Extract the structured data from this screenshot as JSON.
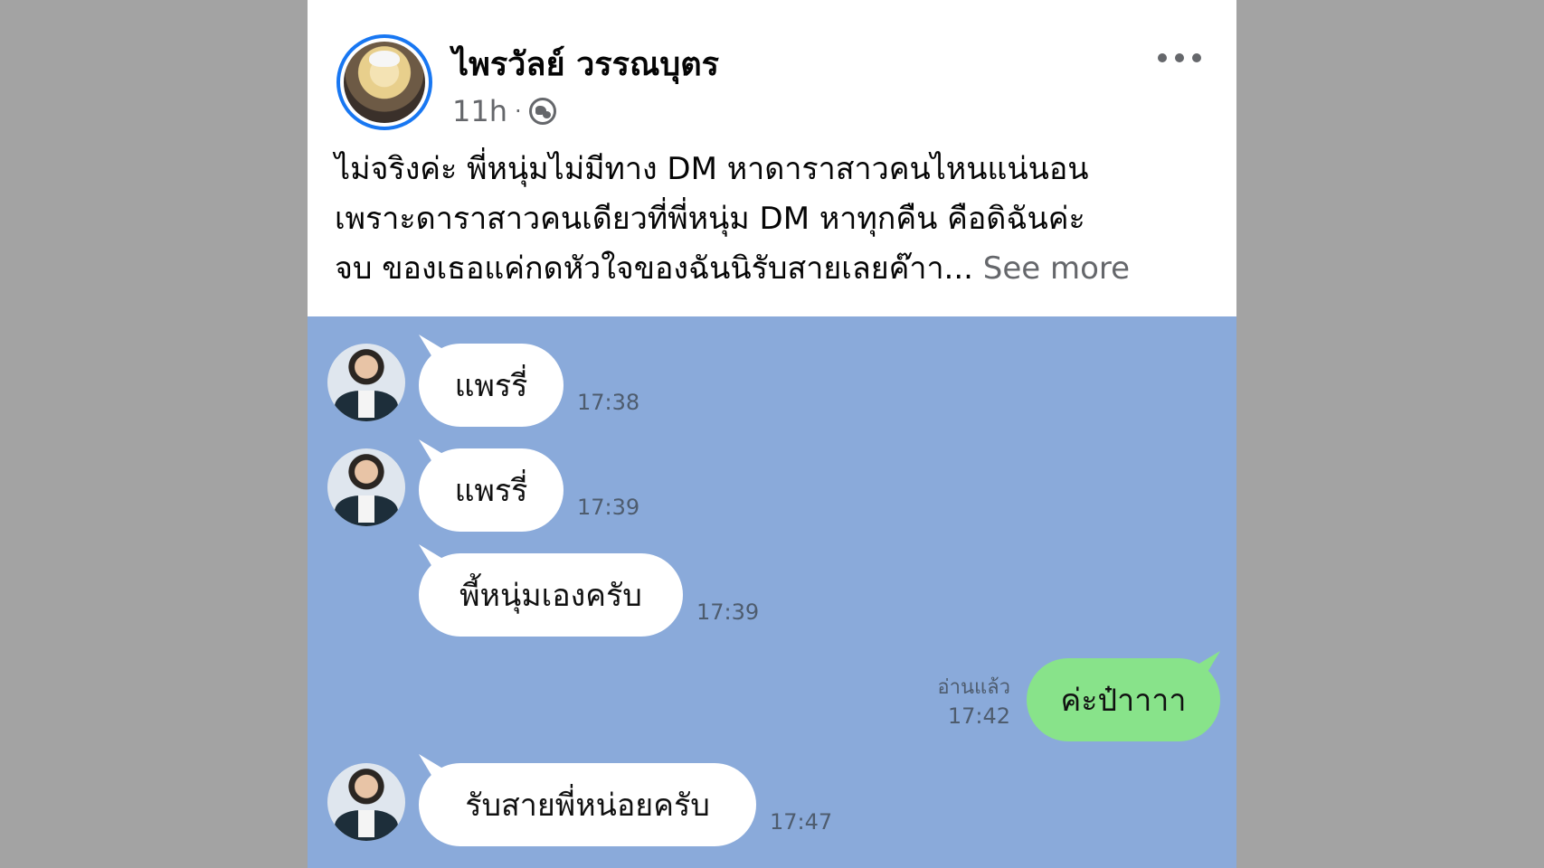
{
  "post": {
    "author": "ไพรวัลย์ วรรณบุตร",
    "time": "11h",
    "separator": "·",
    "audience_icon": "globe-icon",
    "more_icon": "more-dots-icon",
    "text_lines": [
      "ไม่จริงค่ะ พี่หนุ่มไม่มีทาง DM หาดาราสาวคนไหนแน่นอน",
      "เพราะดาราสาวคนเดียวที่พี่หนุ่ม DM หาทุกคืน คือดิฉันค่ะ",
      "จบ ของเธอแค่กดหัวใจของฉันนิรับสายเลยค๊าา..."
    ],
    "see_more": "See more"
  },
  "chat": {
    "background": "#8aaada",
    "messages": [
      {
        "text": "แพรรี่",
        "time": "17:38"
      },
      {
        "text": "แพรรี่",
        "time": "17:39"
      },
      {
        "text": "พี้หนุ่มเองครับ",
        "time": "17:39"
      },
      {
        "text": "ค่ะป๋าาาา",
        "time": "17:42",
        "read": "อ่านแล้ว"
      },
      {
        "text": "รับสายพี่หน่อยครับ",
        "time": "17:47"
      }
    ]
  },
  "colors": {
    "brand_blue": "#1877f2",
    "outgoing_bubble": "#88e38a",
    "incoming_bubble": "#ffffff"
  }
}
